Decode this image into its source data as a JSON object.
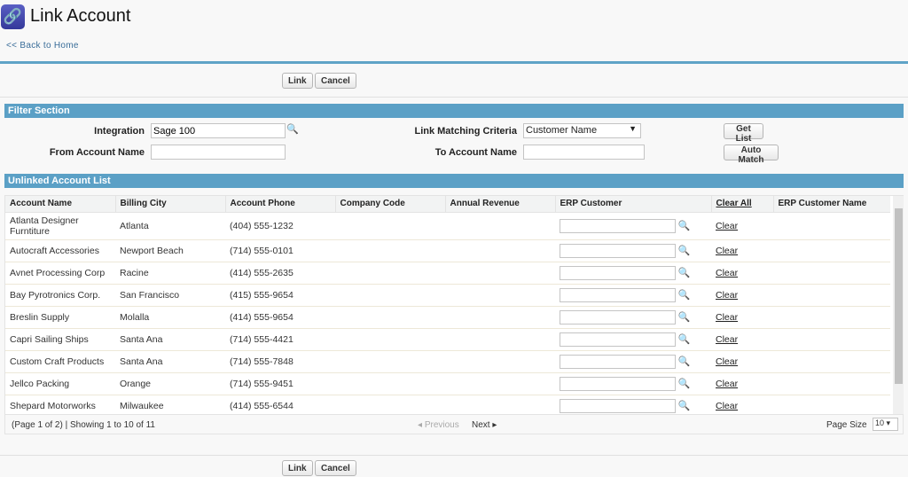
{
  "header": {
    "title": "Link Account",
    "back_link": "<< Back to Home",
    "icon": "link-icon"
  },
  "actions": {
    "link": "Link",
    "cancel": "Cancel"
  },
  "filter": {
    "title": "Filter Section",
    "integration_label": "Integration",
    "integration_value": "Sage 100",
    "from_label": "From Account Name",
    "from_value": "",
    "criteria_label": "Link Matching Criteria",
    "criteria_value": "Customer Name",
    "to_label": "To Account Name",
    "to_value": "",
    "get_list": "Get List",
    "auto_match": "Auto Match"
  },
  "list": {
    "title": "Unlinked Account List",
    "columns": [
      "Account Name",
      "Billing City",
      "Account Phone",
      "Company Code",
      "Annual Revenue",
      "ERP Customer",
      "Clear All",
      "ERP Customer Name"
    ],
    "clear_label": "Clear",
    "rows": [
      [
        "Atlanta Designer Furntiture",
        "Atlanta",
        "(404) 555-1232"
      ],
      [
        "Autocraft Accessories",
        "Newport Beach",
        "(714) 555-0101"
      ],
      [
        "Avnet Processing Corp",
        "Racine",
        "(414) 555-2635"
      ],
      [
        "Bay Pyrotronics Corp.",
        "San Francisco",
        "(415) 555-9654"
      ],
      [
        "Breslin Supply",
        "Molalla",
        "(414) 555-9654"
      ],
      [
        "Capri Sailing Ships",
        "Santa Ana",
        "(714) 555-4421"
      ],
      [
        "Custom Craft Products",
        "Santa Ana",
        "(714) 555-7848"
      ],
      [
        "Jellco Packing",
        "Orange",
        "(714) 555-9451"
      ],
      [
        "Shepard Motorworks",
        "Milwaukee",
        "(414) 555-6544"
      ]
    ],
    "pager": {
      "status": "(Page 1 of 2) | Showing 1 to 10 of 11",
      "previous": "Previous",
      "next": "Next",
      "page_size_label": "Page Size",
      "page_size": "10"
    }
  }
}
